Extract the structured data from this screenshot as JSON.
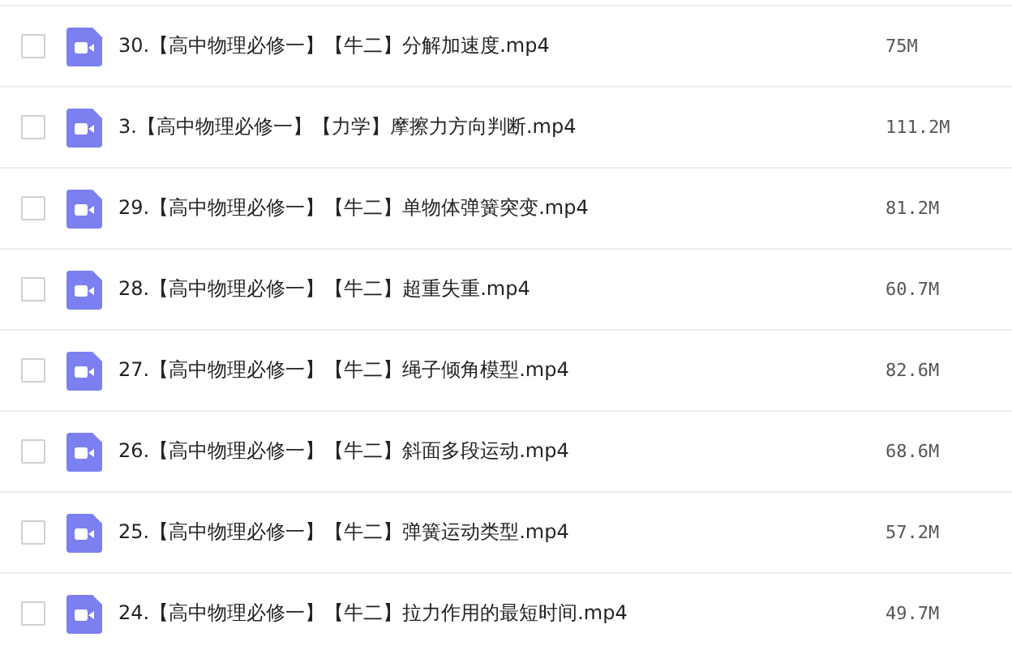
{
  "files": [
    {
      "name": "30.【高中物理必修一】【牛二】分解加速度.mp4",
      "size": "75M",
      "checked": false
    },
    {
      "name": "3.【高中物理必修一】【力学】摩擦力方向判断.mp4",
      "size": "111.2M",
      "checked": false
    },
    {
      "name": "29.【高中物理必修一】【牛二】单物体弹簧突变.mp4",
      "size": "81.2M",
      "checked": false
    },
    {
      "name": "28.【高中物理必修一】【牛二】超重失重.mp4",
      "size": "60.7M",
      "checked": false
    },
    {
      "name": "27.【高中物理必修一】【牛二】绳子倾角模型.mp4",
      "size": "82.6M",
      "checked": false
    },
    {
      "name": "26.【高中物理必修一】【牛二】斜面多段运动.mp4",
      "size": "68.6M",
      "checked": false
    },
    {
      "name": "25.【高中物理必修一】【牛二】弹簧运动类型.mp4",
      "size": "57.2M",
      "checked": false
    },
    {
      "name": "24.【高中物理必修一】【牛二】拉力作用的最短时间.mp4",
      "size": "49.7M",
      "checked": false
    }
  ]
}
